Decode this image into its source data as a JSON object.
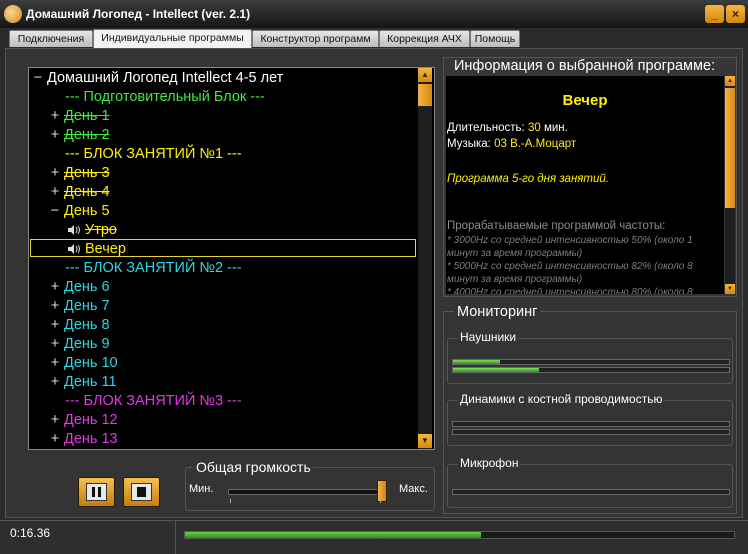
{
  "window": {
    "title": "Домашний Логопед - Intellect  (ver. 2.1)",
    "minimize": "_",
    "close": "×"
  },
  "tabs": [
    {
      "label": "Подключения"
    },
    {
      "label": "Индивидуальные программы"
    },
    {
      "label": "Конструктор программ"
    },
    {
      "label": "Коррекция АЧХ"
    },
    {
      "label": "Помощь"
    }
  ],
  "tree": {
    "items": [
      {
        "exp": "−",
        "label": "Домашний Логопед Intellect 4-5 лет",
        "color": "#ffffff"
      },
      {
        "exp": "",
        "label": "---  Подготовительный Блок ---",
        "color": "#3ee83e"
      },
      {
        "exp": "+",
        "label": "День 1",
        "color": "#3ee83e",
        "strike": true
      },
      {
        "exp": "+",
        "label": "День 2",
        "color": "#3ee83e",
        "strike": true
      },
      {
        "exp": "",
        "label": "--- БЛОК ЗАНЯТИЙ №1 ---",
        "color": "#ffef00"
      },
      {
        "exp": "+",
        "label": "День 3",
        "color": "#ffef00",
        "strike": true
      },
      {
        "exp": "+",
        "label": "День 4",
        "color": "#ffef00",
        "strike": true
      },
      {
        "exp": "−",
        "label": "День 5",
        "color": "#ffef00"
      },
      {
        "exp": "",
        "label": "Утро",
        "color": "#ffef00",
        "strike": true,
        "icon": true
      },
      {
        "exp": "",
        "label": "Вечер",
        "color": "#ffef00",
        "icon": true,
        "selected": true
      },
      {
        "exp": "",
        "label": "--- БЛОК ЗАНЯТИЙ №2 ---",
        "color": "#2ad6e0"
      },
      {
        "exp": "+",
        "label": "День 6",
        "color": "#2ad6e0"
      },
      {
        "exp": "+",
        "label": "День 7",
        "color": "#2ad6e0"
      },
      {
        "exp": "+",
        "label": "День 8",
        "color": "#2ad6e0"
      },
      {
        "exp": "+",
        "label": "День 9",
        "color": "#2ad6e0"
      },
      {
        "exp": "+",
        "label": "День 10",
        "color": "#2ad6e0"
      },
      {
        "exp": "+",
        "label": "День 11",
        "color": "#2ad6e0"
      },
      {
        "exp": "",
        "label": "--- БЛОК ЗАНЯТИЙ №3 ---",
        "color": "#e536e5"
      },
      {
        "exp": "+",
        "label": "День 12",
        "color": "#e536e5"
      },
      {
        "exp": "+",
        "label": "День 13",
        "color": "#e536e5"
      }
    ]
  },
  "info": {
    "header": "Информация о выбранной программе:",
    "program_title": "Вечер",
    "duration_label": "Длительность:",
    "duration_value": "30",
    "duration_unit": "мин.",
    "music_label": "Музыка:",
    "music_value": "03 В.-А.Моцарт",
    "note": "Программа 5-го дня занятий.",
    "freq_header": "Прорабатываемые программой частоты:",
    "freqs": [
      "* 3000Hz со средней интенсивностью 50% (около 1 минут за время программы)",
      "* 5000Hz со средней интенсивностью 82% (около 8 минут за время программы)",
      "* 4000Hz со средней интенсивностью 80% (около 8"
    ]
  },
  "monitor": {
    "header": "Мониторинг",
    "headphones_label": "Наушники",
    "headphones_levels": [
      0.17,
      0.31
    ],
    "bone_label": "Динамики с костной проводимостью",
    "bone_levels": [
      0,
      0
    ],
    "mic_label": "Микрофон",
    "mic_levels": [
      0
    ]
  },
  "volume": {
    "label": "Общая громкость",
    "min_label": "Мин.",
    "max_label": "Макс.",
    "level": 0.99
  },
  "status": {
    "time": "0:16.36",
    "progress": 0.54
  },
  "colors": {
    "accent_orange": "#f0a830",
    "meter_green": "#5ac83c"
  }
}
